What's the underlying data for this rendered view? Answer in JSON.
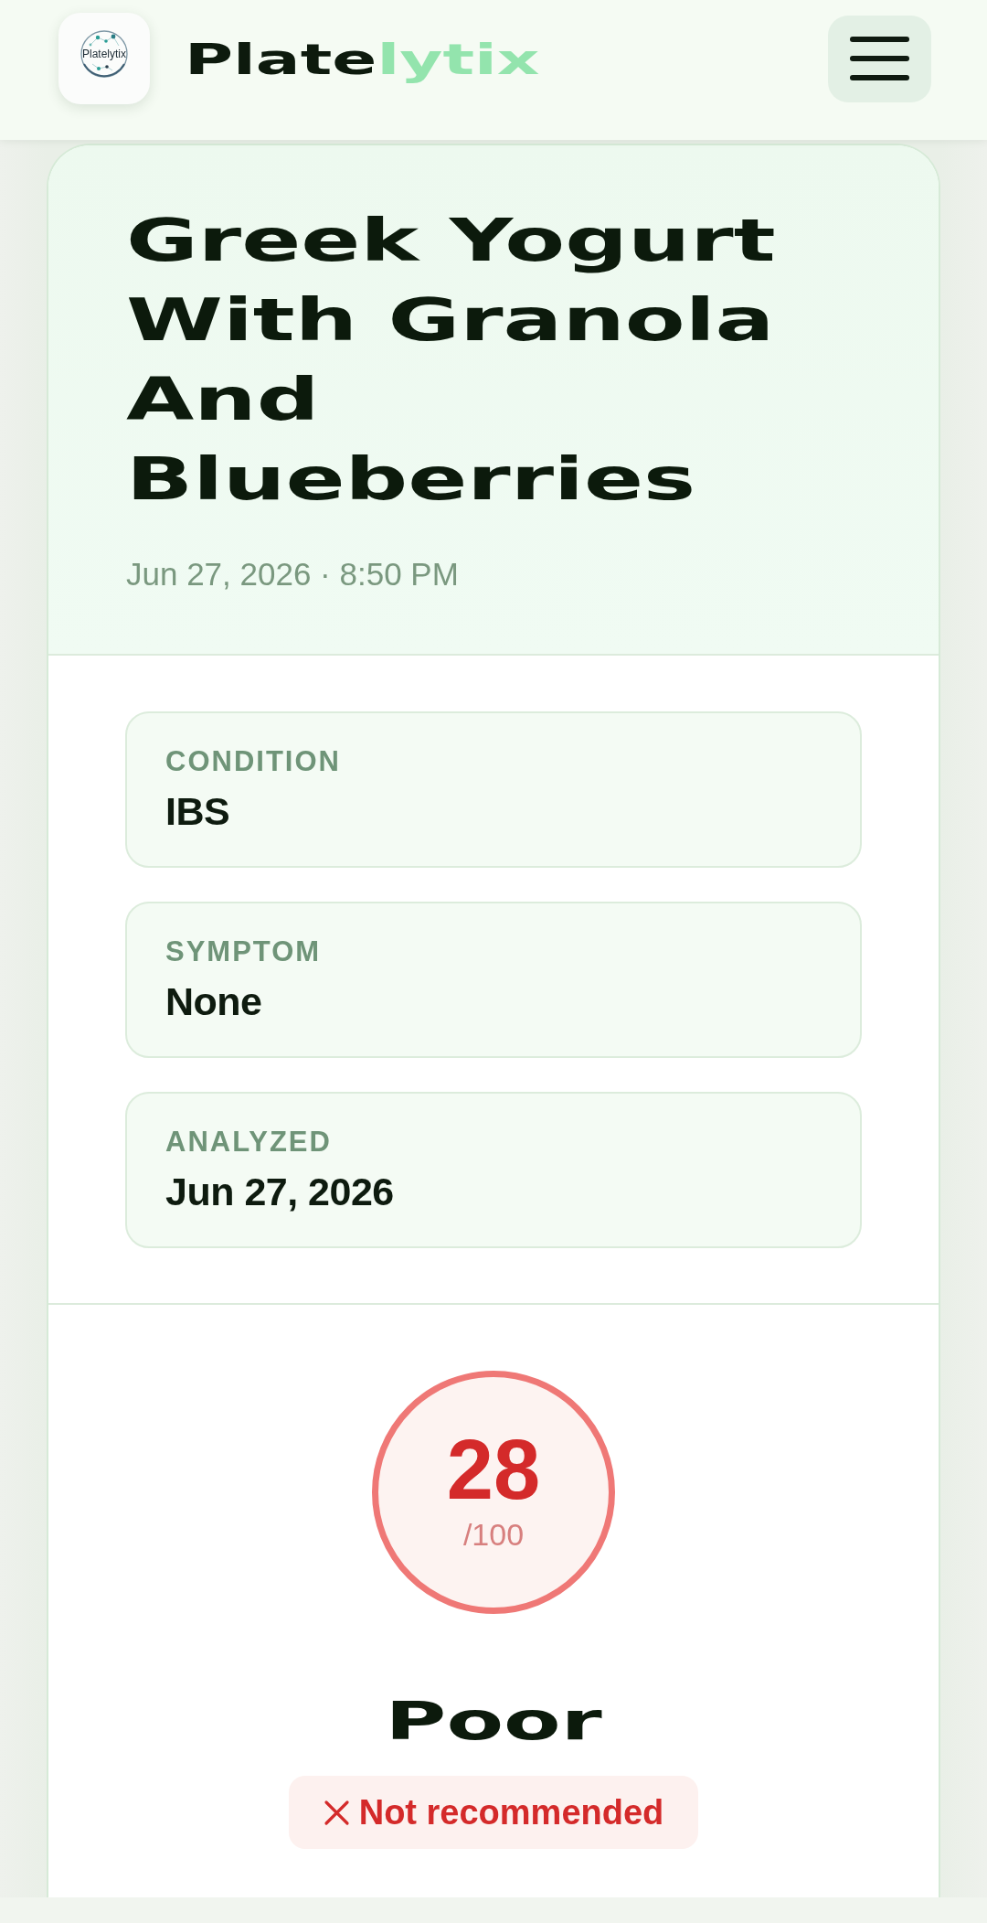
{
  "header": {
    "logo_text": "Platelytix",
    "brand": {
      "dark": "Plate",
      "accent": "lytix"
    }
  },
  "meal": {
    "title": "Greek Yogurt With Granola And Blueberries",
    "timestamp": "Jun 27, 2026 · 8:50 PM"
  },
  "details": [
    {
      "label": "CONDITION",
      "value": "IBS"
    },
    {
      "label": "SYMPTOM",
      "value": "None"
    },
    {
      "label": "ANALYZED",
      "value": "Jun 27, 2026"
    }
  ],
  "score": {
    "value": "28",
    "max": "/100",
    "rating": "Poor",
    "verdict": {
      "kind": "negative",
      "text": "Not recommended"
    }
  }
}
